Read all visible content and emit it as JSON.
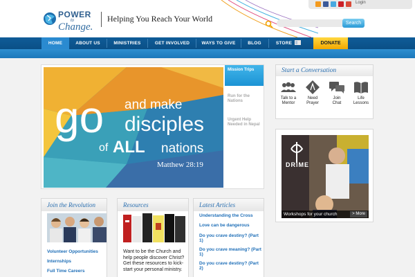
{
  "header": {
    "logo_power": "POWER",
    "logo_to": "to",
    "logo_change": "Change.",
    "tagline": "Helping You Reach Your World",
    "login": "Login",
    "search_placeholder": "",
    "search_button": "Search"
  },
  "nav": {
    "items": [
      "HOME",
      "ABOUT US",
      "MINISTRIES",
      "GET INVOLVED",
      "WAYS TO GIVE",
      "BLOG",
      "STORE"
    ],
    "donate": "DONATE"
  },
  "hero": {
    "go": "go",
    "and_make": "and make",
    "disciples": "disciples",
    "of": "of",
    "all": "ALL",
    "nations": "nations",
    "reference": "Matthew 28:19",
    "tabs": [
      "Mission Trips",
      "Run for the Nations",
      "Urgent Help Needed in Nepal"
    ]
  },
  "conversation": {
    "title": "Start a Conversation",
    "items": [
      {
        "line1": "Talk to a",
        "line2": "Mentor",
        "icon": "people-icon"
      },
      {
        "line1": "Need",
        "line2": "Prayer",
        "icon": "prayer-icon"
      },
      {
        "line1": "Join",
        "line2": "Chat",
        "icon": "chat-icon"
      },
      {
        "line1": "Life",
        "line2": "Lessons",
        "icon": "book-icon"
      }
    ]
  },
  "video": {
    "brand": "DRIME",
    "caption": "Workshops for your church",
    "more": "> More"
  },
  "revolution": {
    "title": "Join the Revolution",
    "links": [
      "Volunteer Opportunities",
      "Internships",
      "Full Time Careers"
    ]
  },
  "resources": {
    "title": "Resources",
    "text": "Want to be the Church and help people discover Christ? Get these resources to kick-start your personal ministry."
  },
  "articles": {
    "title": "Latest Articles",
    "items": [
      "Understanding the Cross",
      "Love can be dangerous",
      "Do you crave destiny? (Part 1)",
      "Do you crave meaning? (Part 1)",
      "Do you crave destiny? (Part 2)"
    ]
  },
  "colors": {
    "brand_blue": "#1b73b3",
    "nav_dark": "#0a4f86",
    "accent_cyan": "#1b93d4",
    "donate_yellow": "#f3a800",
    "link_blue": "#1f6fb8"
  }
}
